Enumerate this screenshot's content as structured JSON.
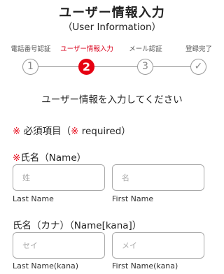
{
  "header": {
    "title": "ユーザー情報入力",
    "subtitle": "（User Information）"
  },
  "steps": [
    {
      "label": "電話番号認証",
      "number": "1",
      "state": "done"
    },
    {
      "label": "ユーザー情報入力",
      "number": "2",
      "state": "active"
    },
    {
      "label": "メール認証",
      "number": "3",
      "state": "pending"
    },
    {
      "label": "登録完了",
      "number": "✓",
      "state": "pending"
    }
  ],
  "instruction": "ユーザー情報を入力してください",
  "required_note": {
    "mark": "※",
    "text": "必須項目（",
    "mark2": "※",
    "text2": " required）"
  },
  "name_section": {
    "mark": "※",
    "label": "氏名（Name）",
    "last": {
      "placeholder": "姓",
      "sublabel": "Last Name"
    },
    "first": {
      "placeholder": "名",
      "sublabel": "First Name"
    }
  },
  "kana_section": {
    "label": "氏名（カナ）（Name[kana]）",
    "last": {
      "placeholder": "セイ",
      "sublabel": "Last Name(kana)"
    },
    "first": {
      "placeholder": "メイ",
      "sublabel": "First Name(kana)"
    }
  },
  "colors": {
    "accent": "#e60012",
    "line": "#9a9a9a"
  }
}
